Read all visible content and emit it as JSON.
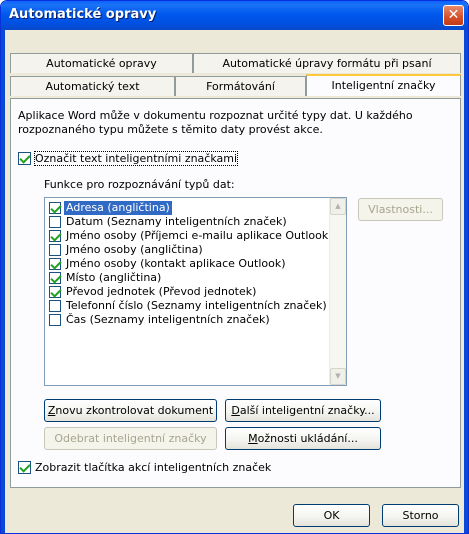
{
  "window": {
    "title": "Automatické opravy",
    "close_glyph": "✕"
  },
  "tabs": {
    "row1": [
      "Automatické opravy",
      "Automatické úpravy formátu při psaní"
    ],
    "row2": [
      "Automatický text",
      "Formátování",
      "Inteligentní značky"
    ],
    "active": "Inteligentní značky"
  },
  "description": "Aplikace Word může v dokumentu rozpoznat určité typy dat. U každého rozpoznaného typu můžete s těmito daty provést akce.",
  "label_checkbox": {
    "label": "Označit text inteligentními značkami",
    "checked": true
  },
  "recognizers": {
    "heading": "Funkce pro rozpoznávání typů dat:",
    "items": [
      {
        "label": "Adresa (angličtina)",
        "checked": true,
        "selected": true
      },
      {
        "label": "Datum (Seznamy inteligentních značek)",
        "checked": false,
        "selected": false
      },
      {
        "label": "Jméno osoby (Příjemci e-mailu aplikace Outlook)",
        "checked": true,
        "selected": false
      },
      {
        "label": "Jméno osoby (angličtina)",
        "checked": false,
        "selected": false
      },
      {
        "label": "Jméno osoby (kontakt aplikace Outlook)",
        "checked": true,
        "selected": false
      },
      {
        "label": "Místo (angličtina)",
        "checked": true,
        "selected": false
      },
      {
        "label": "Převod jednotek (Převod jednotek)",
        "checked": true,
        "selected": false
      },
      {
        "label": "Telefonní číslo (Seznamy inteligentních značek)",
        "checked": false,
        "selected": false
      },
      {
        "label": "Čas (Seznamy inteligentních značek)",
        "checked": false,
        "selected": false
      }
    ]
  },
  "buttons": {
    "properties": "Vlastnosti...",
    "recheck": "Znovu zkontrolovat dokument",
    "more_tags": "Další inteligentní značky...",
    "remove_tags": "Odebrat inteligentní značky",
    "save_options": "Možnosti ukládání...",
    "ok": "OK",
    "cancel": "Storno"
  },
  "show_buttons_checkbox": {
    "label": "Zobrazit tlačítka akcí inteligentních značek",
    "checked": true
  }
}
